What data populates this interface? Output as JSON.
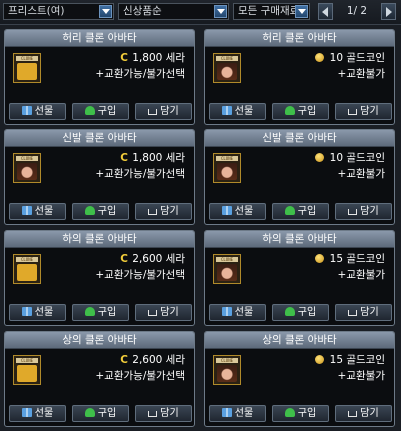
{
  "filters": {
    "job": "프리스트(여)",
    "sort": "신상품순",
    "range": "모든 구매재료"
  },
  "pager": {
    "label": "1/ 2"
  },
  "buttons": {
    "gift": "선물",
    "buy": "구입",
    "cart": "담기"
  },
  "items": [
    {
      "name": "허리 클론 아바타",
      "currency": "seria",
      "symbol": "C",
      "price": "1,800 세라",
      "note": "+교환가능/불가선택",
      "icon": "waist-avatar-icon"
    },
    {
      "name": "허리 클론 아바타",
      "currency": "gold",
      "symbol": "",
      "price": "10 골드코인",
      "note": "+교환불가",
      "icon": "waist-avatar-icon"
    },
    {
      "name": "신발 클론 아바타",
      "currency": "seria",
      "symbol": "C",
      "price": "1,800 세라",
      "note": "+교환가능/불가선택",
      "icon": "shoes-avatar-icon"
    },
    {
      "name": "신발 클론 아바타",
      "currency": "gold",
      "symbol": "",
      "price": "10 골드코인",
      "note": "+교환불가",
      "icon": "shoes-avatar-icon"
    },
    {
      "name": "하의 클론 아바타",
      "currency": "seria",
      "symbol": "C",
      "price": "2,600 세라",
      "note": "+교환가능/불가선택",
      "icon": "pants-avatar-icon"
    },
    {
      "name": "하의 클론 아바타",
      "currency": "gold",
      "symbol": "",
      "price": "15 골드코인",
      "note": "+교환불가",
      "icon": "pants-avatar-icon"
    },
    {
      "name": "상의 클론 아바타",
      "currency": "seria",
      "symbol": "C",
      "price": "2,600 세라",
      "note": "+교환가능/불가선택",
      "icon": "top-avatar-icon"
    },
    {
      "name": "상의 클론 아바타",
      "currency": "gold",
      "symbol": "",
      "price": "15 골드코인",
      "note": "+교환불가",
      "icon": "top-avatar-icon"
    }
  ],
  "icon_label": "CLONE"
}
